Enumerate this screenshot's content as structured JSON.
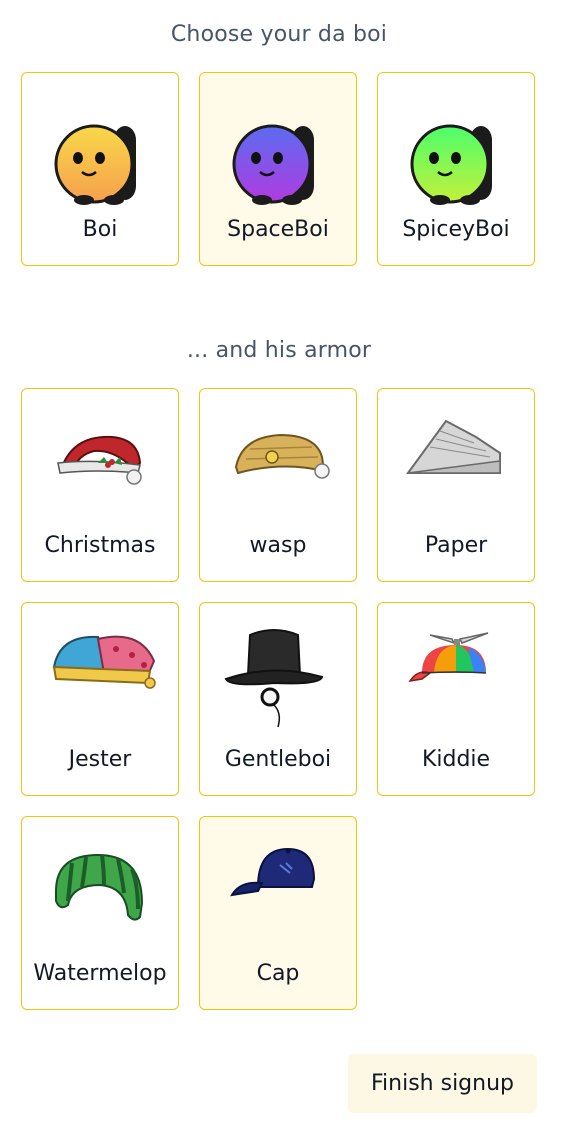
{
  "boi_section": {
    "heading": "Choose your da boi",
    "options": [
      {
        "label": "Boi",
        "icon": "yellow-boi-icon",
        "colors": [
          "#f9d84a",
          "#f6a04d"
        ],
        "selected": false
      },
      {
        "label": "SpaceBoi",
        "icon": "purple-boi-icon",
        "colors": [
          "#5b6cf0",
          "#b03be0"
        ],
        "selected": true
      },
      {
        "label": "SpiceyBoi",
        "icon": "green-boi-icon",
        "colors": [
          "#4cff6b",
          "#c3f03a"
        ],
        "selected": false
      }
    ]
  },
  "armor_section": {
    "heading": "... and his armor",
    "options": [
      {
        "label": "Christmas",
        "icon": "santa-hat-icon",
        "selected": false
      },
      {
        "label": "wasp",
        "icon": "wasp-beanie-icon",
        "selected": false
      },
      {
        "label": "Paper",
        "icon": "paper-hat-icon",
        "selected": false
      },
      {
        "label": "Jester",
        "icon": "jester-hat-icon",
        "selected": false
      },
      {
        "label": "Gentleboi",
        "icon": "top-hat-monocle-icon",
        "selected": false
      },
      {
        "label": "Kiddie",
        "icon": "propeller-cap-icon",
        "selected": false
      },
      {
        "label": "Watermelop",
        "icon": "watermelon-helmet-icon",
        "selected": false
      },
      {
        "label": "Cap",
        "icon": "baseball-cap-icon",
        "selected": true
      }
    ]
  },
  "finish_button": {
    "label": "Finish signup"
  },
  "colors": {
    "card_border": "#f1c40f",
    "selected_bg": "#fffbe8",
    "heading": "#475569"
  }
}
